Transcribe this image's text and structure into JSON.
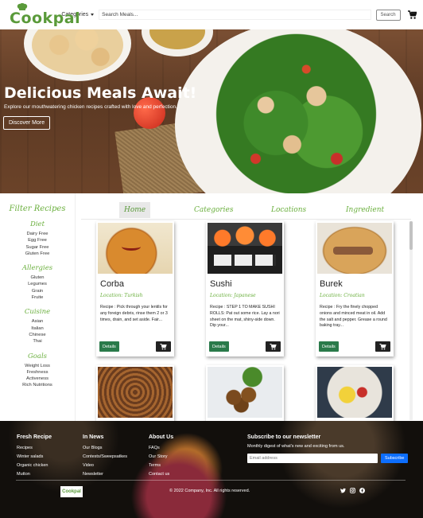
{
  "navbar": {
    "logo": "Cookpal",
    "categories_label": "Categories",
    "search_placeholder": "Search Meals...",
    "search_button": "Search"
  },
  "hero": {
    "title": "Delicious Meals Await!",
    "subtitle": "Explore our mouthwatering chicken recipes crafted with love and perfection.",
    "button": "Discover More"
  },
  "sidebar": {
    "title": "Filter Recipes",
    "groups": [
      {
        "head": "Diet",
        "items": [
          "Dairy Free",
          "Egg Free",
          "Sugar Free",
          "Gluten Free"
        ]
      },
      {
        "head": "Allergies",
        "items": [
          "Gluten",
          "Legumes",
          "Grain",
          "Fruite"
        ]
      },
      {
        "head": "Cuisine",
        "items": [
          "Asian",
          "Italian",
          "Chinese",
          "Thai"
        ]
      },
      {
        "head": "Goals",
        "items": [
          "Weight Loss",
          "Freshness",
          "Activeness",
          "Rich Nutritions"
        ]
      }
    ]
  },
  "tabs": [
    "Home",
    "Categories",
    "Locations",
    "Ingredient"
  ],
  "cards": [
    {
      "name": "Corba",
      "location": "Location: Turkish",
      "desc": "Recipe : Pick through your lentils for any foreign debris, rinse them 2 or 3 times, drain, and set aside. Fair...",
      "button": "Details"
    },
    {
      "name": "Sushi",
      "location": "Location: Japanese",
      "desc": "Recipe : STEP 1 TO MAKE SUSHI ROLLS: Pat out some rice. Lay a nori sheet on the mat, shiny-side down. Dip your...",
      "button": "Details"
    },
    {
      "name": "Burek",
      "location": "Location: Croatian",
      "desc": "Recipe : Fry the finely chopped onions and minced meat in oil. Add the salt and pepper. Grease a round baking tray...",
      "button": "Details"
    }
  ],
  "footer": {
    "col1": {
      "head": "Fresh Recipe",
      "links": [
        "Recipes",
        "Winter salads",
        "Organic chicken",
        "Mutton"
      ]
    },
    "col2": {
      "head": "In News",
      "links": [
        "Our Blogs",
        "Contests/Sweepsatkes",
        "Video",
        "Newsletter"
      ]
    },
    "col3": {
      "head": "About Us",
      "links": [
        "FAQs",
        "Our Story",
        "Terms",
        "Contact us"
      ]
    },
    "newsletter": {
      "head": "Subscribe to our newsletter",
      "sub": "Monthly digest of what's new and exciting from us.",
      "placeholder": "Email address",
      "button": "Subscribe"
    },
    "logo": "Cookpal",
    "copyright": "© 2022 Company, Inc. All rights reserved."
  },
  "colors": {
    "brand_green": "#6aaf3d",
    "details_button": "#2a7a4a",
    "subscribe_button": "#0d6efd"
  },
  "icons": [
    "chef-hat-icon",
    "caret-down-icon",
    "cart-icon",
    "twitter-icon",
    "instagram-icon",
    "facebook-icon"
  ]
}
